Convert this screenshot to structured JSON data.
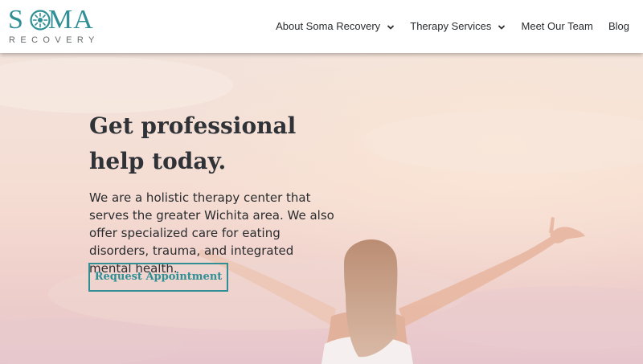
{
  "brand": {
    "name": "SOMA",
    "name_left": "S",
    "name_right": "MA",
    "subtitle": "RECOVERY",
    "logo_icon": "sun-flower-mark",
    "accent_color": "#2f8f95"
  },
  "nav": {
    "items": [
      {
        "label": "About Soma Recovery",
        "has_dropdown": true
      },
      {
        "label": "Therapy Services",
        "has_dropdown": true
      },
      {
        "label": "Meet Our Team",
        "has_dropdown": false
      },
      {
        "label": "Blog",
        "has_dropdown": false
      }
    ]
  },
  "hero": {
    "title_line1": "Get professional",
    "title_line2": "help today.",
    "body": "We are a holistic therapy center that serves the greater Wichita area. We also offer specialized care for eating disorders, trauma, and integrated mental health.",
    "cta_label": "Request Appointment",
    "image": "woman-raising-arms-at-sunset-photo"
  }
}
